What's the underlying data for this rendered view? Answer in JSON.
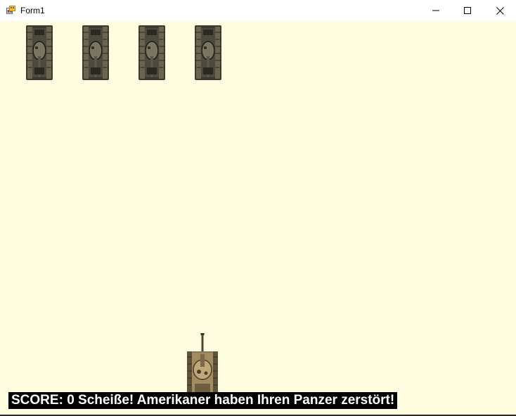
{
  "window": {
    "title": "Form1",
    "icon": "winforms-app-icon",
    "buttons": {
      "minimize_icon": "minimize-icon",
      "maximize_icon": "maximize-icon",
      "close_icon": "close-icon"
    }
  },
  "game": {
    "background_color": "#fffde0",
    "enemies": [
      {
        "icon": "enemy-tank-icon"
      },
      {
        "icon": "enemy-tank-icon"
      },
      {
        "icon": "enemy-tank-icon"
      },
      {
        "icon": "enemy-tank-icon"
      }
    ],
    "player": {
      "icon": "player-tank-icon"
    },
    "score_label": {
      "prefix": "SCORE:",
      "score": "0",
      "message": "Scheiße! Amerikaner haben Ihren Panzer zerstört!"
    }
  }
}
